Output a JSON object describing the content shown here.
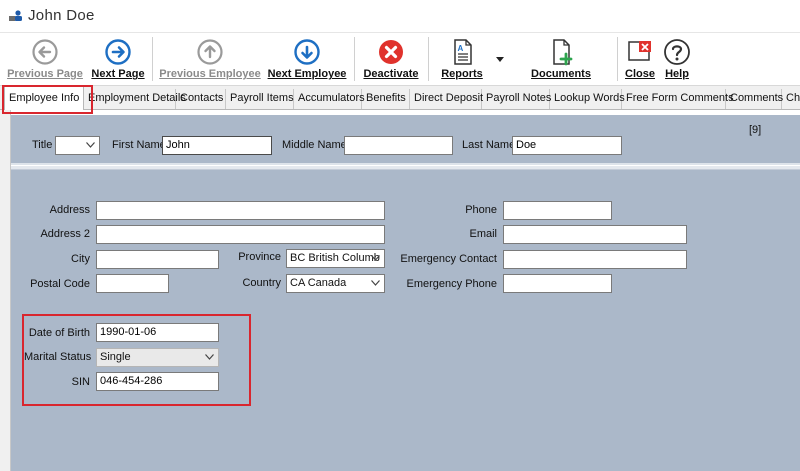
{
  "window": {
    "title": "John  Doe",
    "icon": "employee-icon"
  },
  "toolbar": {
    "previous_page": "Previous Page",
    "next_page": "Next Page",
    "previous_employee": "Previous Employee",
    "next_employee": "Next Employee",
    "deactivate": "Deactivate",
    "reports": "Reports",
    "documents": "Documents",
    "close": "Close",
    "help": "Help"
  },
  "tabs": [
    "Employee Info",
    "Employment Details",
    "Contacts",
    "Payroll Items",
    "Accumulators",
    "Benefits",
    "Direct Deposit",
    "Payroll Notes",
    "Lookup Words",
    "Free Form Comments",
    "Comments",
    "Ch"
  ],
  "active_tab": "Employee Info",
  "header": {
    "title_label": "Title",
    "title_value": "",
    "first_name_label": "First Name",
    "first_name_value": "John",
    "middle_name_label": "Middle Name",
    "middle_name_value": "",
    "last_name_label": "Last Name",
    "last_name_value": "Doe",
    "record_count": "[9]"
  },
  "address": {
    "address_label": "Address",
    "address_value": "",
    "address2_label": "Address 2",
    "address2_value": "",
    "city_label": "City",
    "city_value": "",
    "postal_label": "Postal Code",
    "postal_value": "",
    "province_label": "Province",
    "province_value": "BC  British Columb",
    "country_label": "Country",
    "country_value": "CA Canada"
  },
  "contact": {
    "phone_label": "Phone",
    "phone_value": "",
    "email_label": "Email",
    "email_value": "",
    "emergency_contact_label": "Emergency Contact",
    "emergency_contact_value": "",
    "emergency_phone_label": "Emergency Phone",
    "emergency_phone_value": ""
  },
  "personal": {
    "dob_label": "Date of Birth",
    "dob_value": "1990-01-06",
    "marital_label": "Marital Status",
    "marital_value": "Single",
    "sin_label": "SIN",
    "sin_value": "046-454-286"
  },
  "colors": {
    "panel": "#abb8c9",
    "highlight": "#d9262e",
    "nav_blue": "#1e6fc3",
    "deactivate_red": "#e0322c"
  }
}
